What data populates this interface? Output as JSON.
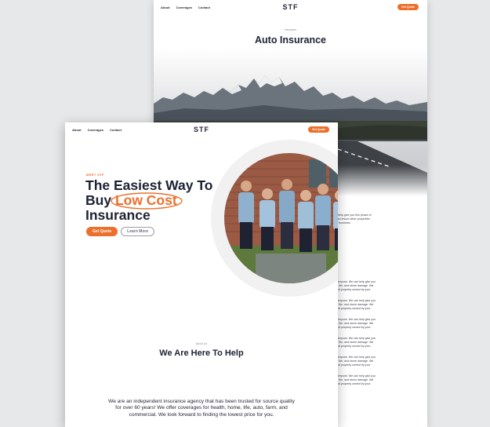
{
  "back_page": {
    "nav": {
      "links": [
        "About",
        "Coverages",
        "Contact"
      ],
      "logo": "STF",
      "cta": "Get Quote"
    },
    "eyebrow": "Insurance",
    "title": "Auto Insurance",
    "partial_heading": "r",
    "partial_intro": [
      "n help give you this peace of",
      "also insure other properties",
      "ur business."
    ],
    "partial_blocks": [
      [
        "everyone. We can help give you",
        "ft, fire, and storm damage. We",
        "and property owned by your"
      ],
      [
        "everyone. We can help give you",
        "ft, fire, and storm damage. We",
        "and property owned by your"
      ],
      [
        "everyone. We can help give you",
        "ft, fire, and storm damage. We",
        "and property owned by your"
      ],
      [
        "everyone. We can help give you",
        "ft, fire, and storm damage. We",
        "and property owned by your"
      ],
      [
        "everyone. We can help give you",
        "ft, fire, and storm damage. We",
        "and property owned by your"
      ],
      [
        "everyone. We can help give you",
        "ft, fire, and storm damage. We",
        "and property owned by your"
      ]
    ]
  },
  "front_page": {
    "nav": {
      "links": [
        "About",
        "Coverages",
        "Contact"
      ],
      "logo": "STF",
      "cta": "Get Quote"
    },
    "eyebrow": "MEET STF",
    "headline_1": "The Easiest Way To",
    "headline_2a": "Buy",
    "headline_highlight": "Low Cost",
    "headline_3": "Insurance",
    "primary_button": "Get Quote",
    "secondary_button": "Learn More",
    "about_eyebrow": "About Us",
    "section_title": "We Are Here To Help",
    "about_text": "We are an independent insurance agency that has been trusted for source quality for over 60 years! We offer coverages for health, home, life, auto, farm, and commercial.  We look forward to finding the lowest price for you."
  },
  "colors": {
    "accent": "#ec6f2b",
    "navy": "#1e2233",
    "background": "#e7e8ea"
  }
}
